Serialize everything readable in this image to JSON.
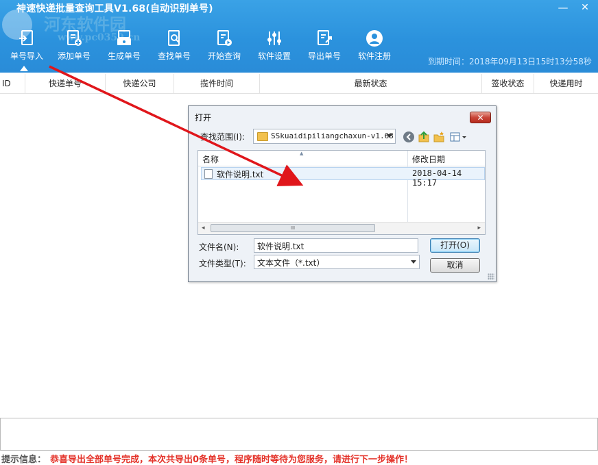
{
  "app": {
    "title": "神速快递批量查询工具V1.68(自动识别单号)",
    "minimize_glyph": "—",
    "close_glyph": "✕",
    "expiry_text": "到期时间：2018年09月13日15时13分58秒"
  },
  "watermark": {
    "site_name": "河东软件园",
    "url": "www.pc0359.cn"
  },
  "toolbar": {
    "items": [
      {
        "label": "单号导入",
        "icon": "import-icon"
      },
      {
        "label": "添加单号",
        "icon": "add-document-icon"
      },
      {
        "label": "生成单号",
        "icon": "generate-icon"
      },
      {
        "label": "查找单号",
        "icon": "search-document-icon"
      },
      {
        "label": "开始查询",
        "icon": "play-document-icon"
      },
      {
        "label": "软件设置",
        "icon": "settings-sliders-icon"
      },
      {
        "label": "导出单号",
        "icon": "export-icon"
      },
      {
        "label": "软件注册",
        "icon": "user-register-icon"
      }
    ],
    "active_index": 0
  },
  "table": {
    "columns": [
      "ID",
      "快递单号",
      "快递公司",
      "揽件时间",
      "最新状态",
      "签收状态",
      "快递用时"
    ],
    "rows": []
  },
  "status": {
    "label": "提示信息：",
    "message": "恭喜导出全部单号完成，本次共导出0条单号，程序随时等待为您服务，请进行下一步操作！"
  },
  "colors": {
    "header_blue": "#2b92dd",
    "status_red": "#e4332a",
    "arrow_red": "#e0161b"
  },
  "open_dialog": {
    "title": "打开",
    "close_glyph": "✕",
    "look_in_label": "查找范围(I):",
    "look_in_value": "SSkuaidipiliangchaxun-v1.68",
    "list_headers": {
      "name": "名称",
      "modified": "修改日期"
    },
    "files": [
      {
        "name": "软件说明.txt",
        "modified": "2018-04-14 15:17"
      }
    ],
    "file_name_label": "文件名(N):",
    "file_name_value": "软件说明.txt",
    "file_type_label": "文件类型(T):",
    "file_type_value": "文本文件（*.txt）",
    "open_button": "打开(O)",
    "cancel_button": "取消",
    "scroll_thumb_glyph": "III"
  }
}
